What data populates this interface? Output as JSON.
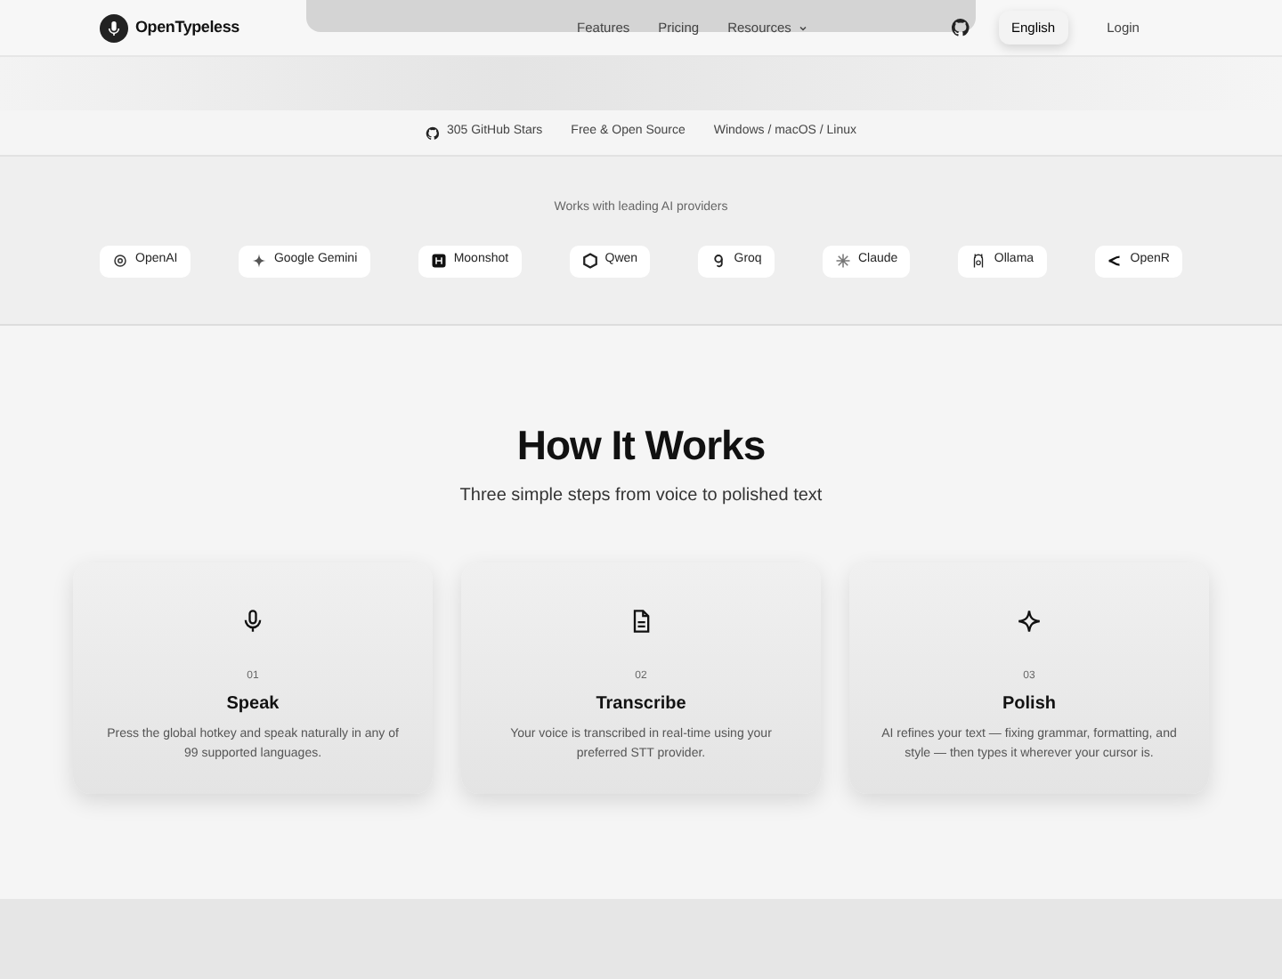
{
  "brand": {
    "name": "OpenTypeless"
  },
  "nav": {
    "links": [
      {
        "label": "Features",
        "kind": "link"
      },
      {
        "label": "Pricing",
        "kind": "link"
      },
      {
        "label": "Resources",
        "kind": "dropdown"
      }
    ],
    "language": "English",
    "login": "Login"
  },
  "stats": [
    {
      "label": "305 GitHub Stars",
      "kind": "github"
    },
    {
      "label": "Free & Open Source",
      "kind": "text"
    },
    {
      "label": "Windows / macOS / Linux",
      "kind": "text"
    }
  ],
  "providers": {
    "heading": "Works with leading AI providers",
    "items": [
      {
        "name": "OpenAI",
        "kind": "openai"
      },
      {
        "name": "Google Gemini",
        "kind": "gemini"
      },
      {
        "name": "Moonshot",
        "kind": "moonshot"
      },
      {
        "name": "Qwen",
        "kind": "qwen"
      },
      {
        "name": "Groq",
        "kind": "groq"
      },
      {
        "name": "Claude",
        "kind": "claude"
      },
      {
        "name": "Ollama",
        "kind": "ollama"
      },
      {
        "name": "OpenR",
        "kind": "openrouter"
      }
    ]
  },
  "how_it_works": {
    "title": "How It Works",
    "subtitle": "Three simple steps from voice to polished text",
    "steps": [
      {
        "number": "01",
        "title": "Speak",
        "text": "Press the global hotkey and speak naturally in any of 99 supported languages.",
        "kind": "mic"
      },
      {
        "number": "02",
        "title": "Transcribe",
        "text": "Your voice is transcribed in real-time using your preferred STT provider.",
        "kind": "document"
      },
      {
        "number": "03",
        "title": "Polish",
        "text": "AI refines your text — fixing grammar, formatting, and style — then types it wherever your cursor is.",
        "kind": "sparkle"
      }
    ]
  }
}
